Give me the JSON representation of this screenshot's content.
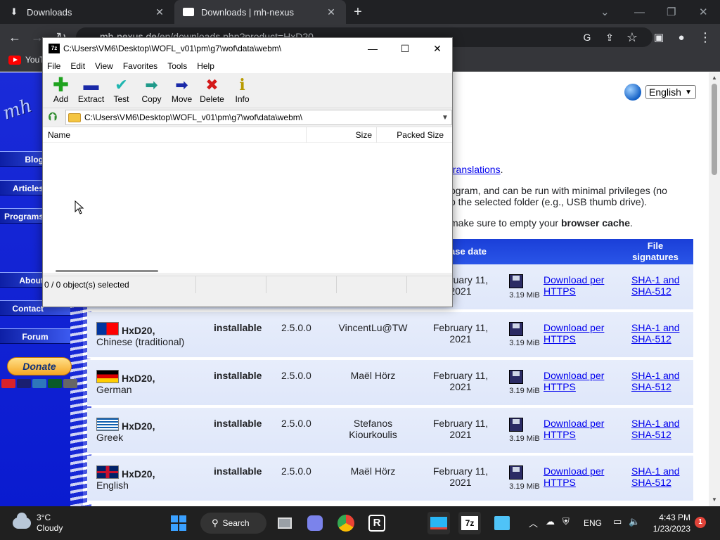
{
  "browser": {
    "tabs": [
      {
        "title": "Downloads",
        "icon": "download-icon"
      },
      {
        "title": "Downloads | mh-nexus",
        "icon": "mh-nexus-favicon"
      }
    ],
    "url_host": "mh-nexus.de",
    "url_path": "/en/downloads.php?product=HxD20",
    "bookmark": "YouTube"
  },
  "site": {
    "logo": "mh",
    "nav": [
      "Blog",
      "Articles",
      "Programs",
      "About",
      "Contact",
      "Forum"
    ],
    "donate": "Donate",
    "language": "English",
    "text": {
      "translations_link": "translations",
      "translations_tail": ".",
      "line1": "ogram, and can be run with minimal privileges (no",
      "line2": "o the selected folder (e.g., USB thumb drive).",
      "line3_pre": "make sure to empty your ",
      "line3_bold": "browser cache",
      "line3_post": "."
    },
    "table": {
      "headers": {
        "date": "ase date",
        "sig": "File signatures"
      },
      "first_row": {
        "date": "February 11, 2021",
        "size": "3.19 MiB",
        "dl": "Download per HTTPS",
        "sig": "SHA-1 and SHA-512"
      },
      "rows": [
        {
          "name": "HxD20,",
          "lang": "Chinese (traditional)",
          "type": "installable",
          "version": "2.5.0.0",
          "author": "VincentLu@TW",
          "date": "February 11, 2021",
          "size": "3.19 MiB",
          "dl": "Download per HTTPS",
          "sig": "SHA-1 and SHA-512",
          "flag": "taiwan"
        },
        {
          "name": "HxD20,",
          "lang": "German",
          "type": "installable",
          "version": "2.5.0.0",
          "author": "Maël Hörz",
          "date": "February 11, 2021",
          "size": "3.19 MiB",
          "dl": "Download per HTTPS",
          "sig": "SHA-1 and SHA-512",
          "flag": "germany"
        },
        {
          "name": "HxD20,",
          "lang": "Greek",
          "type": "installable",
          "version": "2.5.0.0",
          "author": "Stefanos Kiourkoulis",
          "date": "February 11, 2021",
          "size": "3.19 MiB",
          "dl": "Download per HTTPS",
          "sig": "SHA-1 and SHA-512",
          "flag": "greece"
        },
        {
          "name": "HxD20,",
          "lang": "English",
          "type": "installable",
          "version": "2.5.0.0",
          "author": "Maël Hörz",
          "date": "February 11, 2021",
          "size": "3.19 MiB",
          "dl": "Download per HTTPS",
          "sig": "SHA-1 and SHA-512",
          "flag": "uk"
        }
      ]
    }
  },
  "zip": {
    "title": "C:\\Users\\VM6\\Desktop\\WOFL_v01\\pm\\g7\\wof\\data\\webm\\",
    "menu": [
      "File",
      "Edit",
      "View",
      "Favorites",
      "Tools",
      "Help"
    ],
    "tools": [
      "Add",
      "Extract",
      "Test",
      "Copy",
      "Move",
      "Delete",
      "Info"
    ],
    "path": "C:\\Users\\VM6\\Desktop\\WOFL_v01\\pm\\g7\\wof\\data\\webm\\",
    "columns": [
      "Name",
      "Size",
      "Packed Size"
    ],
    "status": "0 / 0 object(s) selected"
  },
  "taskbar": {
    "temp": "3°C",
    "condition": "Cloudy",
    "search": "Search",
    "lang": "ENG",
    "time": "4:43 PM",
    "date": "1/23/2023",
    "notifications": "1"
  },
  "colors": {
    "site_blue": "#1a2bd8",
    "row_bg": "#e3eafa",
    "link": "#0000ee",
    "taskbar": "#202020"
  }
}
